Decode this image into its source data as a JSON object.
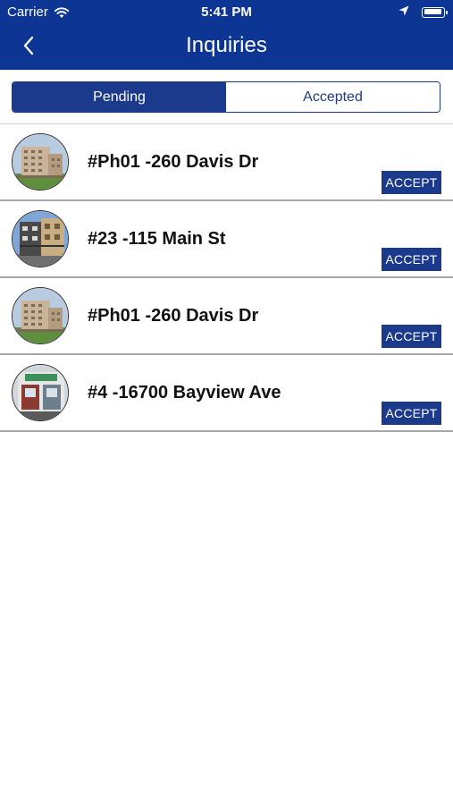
{
  "status_bar": {
    "carrier": "Carrier",
    "time": "5:41 PM"
  },
  "nav": {
    "title": "Inquiries",
    "back_icon": "chevron-left-icon"
  },
  "tabs": [
    {
      "label": "Pending",
      "active": true
    },
    {
      "label": "Accepted",
      "active": false
    }
  ],
  "colors": {
    "header": "#0d3594",
    "accent": "#1c3a8c"
  },
  "inquiries": [
    {
      "address": "#Ph01 -260 Davis Dr",
      "action": "ACCEPT",
      "thumbnail": "apartment-tower-photo"
    },
    {
      "address": "#23 -115 Main St",
      "action": "ACCEPT",
      "thumbnail": "townhouse-photo"
    },
    {
      "address": "#Ph01 -260 Davis Dr",
      "action": "ACCEPT",
      "thumbnail": "apartment-tower-photo"
    },
    {
      "address": "#4 -16700 Bayview Ave",
      "action": "ACCEPT",
      "thumbnail": "storefront-photo"
    }
  ]
}
